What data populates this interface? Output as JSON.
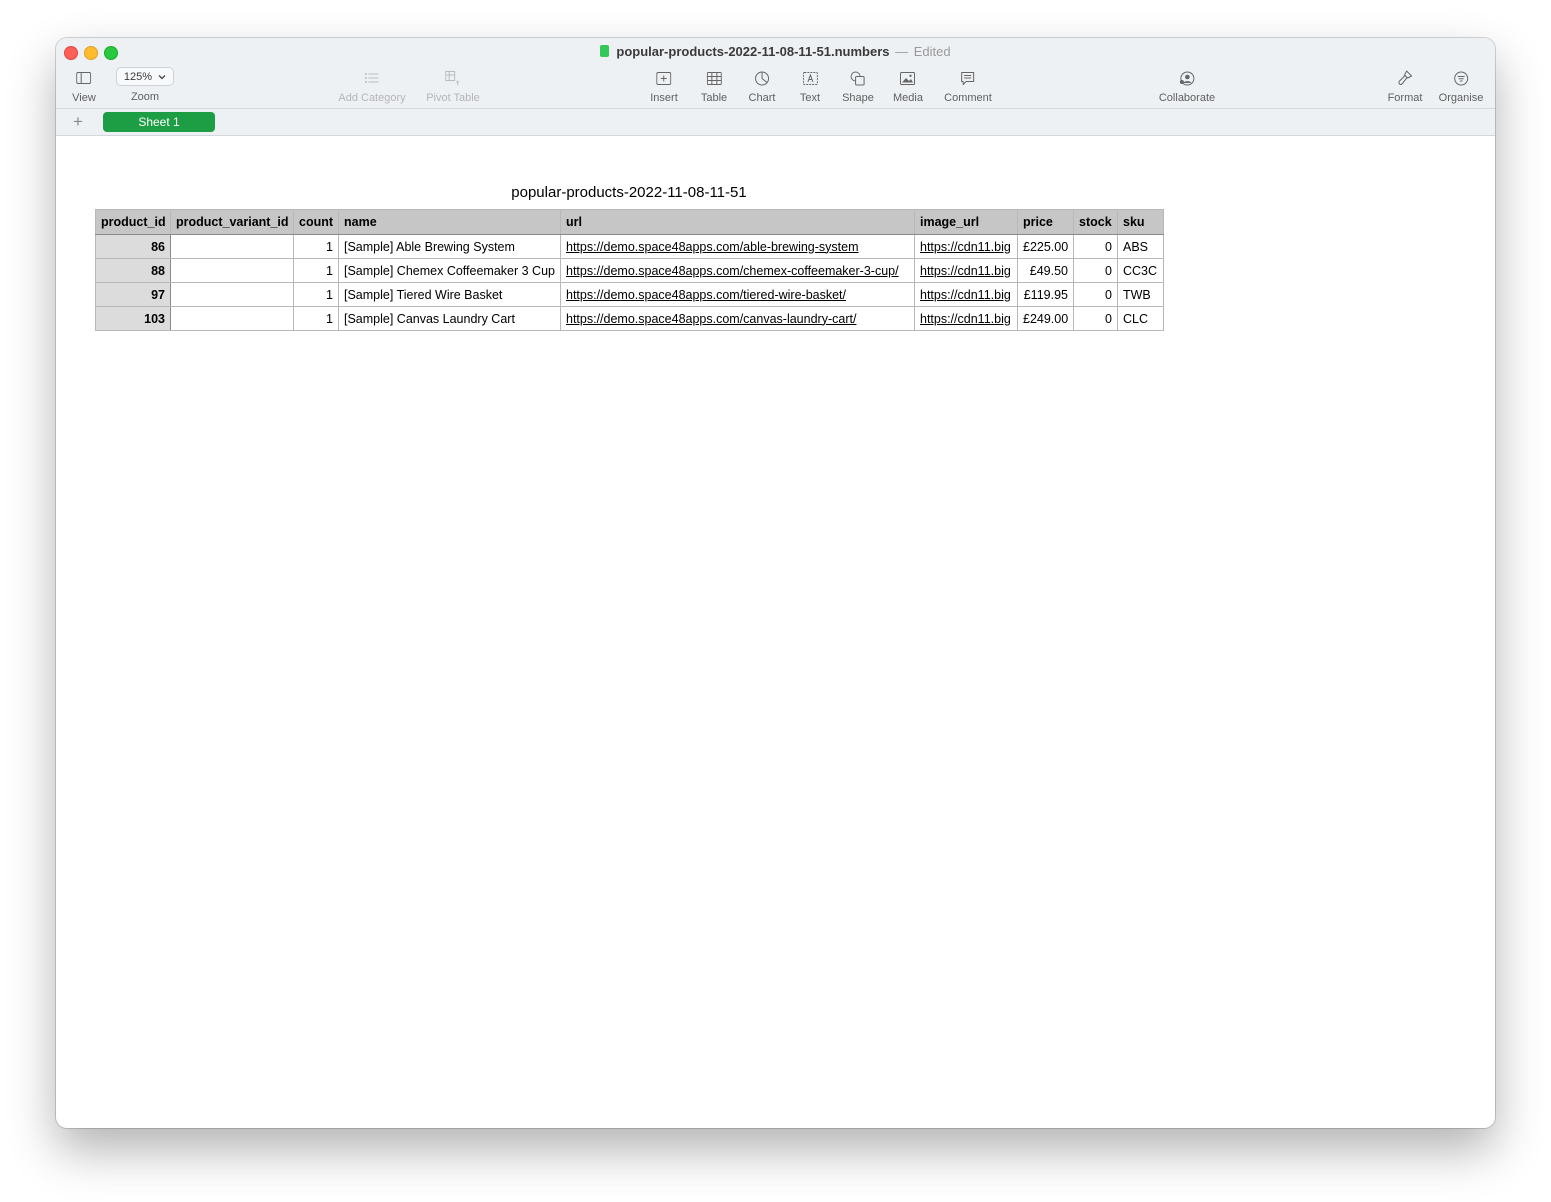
{
  "window": {
    "file_name": "popular-products-2022-11-08-11-51.numbers",
    "separator": "—",
    "status": "Edited"
  },
  "toolbar": {
    "view": "View",
    "zoom_value": "125%",
    "zoom": "Zoom",
    "add_category": "Add Category",
    "pivot_table": "Pivot Table",
    "insert": "Insert",
    "table": "Table",
    "chart": "Chart",
    "text": "Text",
    "shape": "Shape",
    "media": "Media",
    "comment": "Comment",
    "collaborate": "Collaborate",
    "format": "Format",
    "organise": "Organise"
  },
  "sheets": {
    "add": "+",
    "tabs": [
      "Sheet 1"
    ]
  },
  "table": {
    "title": "popular-products-2022-11-08-11-51",
    "columns": [
      "product_id",
      "product_variant_id",
      "count",
      "name",
      "url",
      "image_url",
      "price",
      "stock",
      "sku"
    ],
    "rows": [
      [
        "86",
        "",
        "1",
        "[Sample] Able Brewing System",
        "https://demo.space48apps.com/able-brewing-system",
        "https://cdn11.big",
        "£225.00",
        "0",
        "ABS"
      ],
      [
        "88",
        "",
        "1",
        "[Sample] Chemex Coffeemaker 3 Cup",
        "https://demo.space48apps.com/chemex-coffeemaker-3-cup/",
        "https://cdn11.big",
        "£49.50",
        "0",
        "CC3C"
      ],
      [
        "97",
        "",
        "1",
        "[Sample] Tiered Wire Basket",
        "https://demo.space48apps.com/tiered-wire-basket/",
        "https://cdn11.big",
        "£119.95",
        "0",
        "TWB"
      ],
      [
        "103",
        "",
        "1",
        "[Sample] Canvas Laundry Cart",
        "https://demo.space48apps.com/canvas-laundry-cart/",
        "https://cdn11.big",
        "£249.00",
        "0",
        "CLC"
      ]
    ]
  }
}
